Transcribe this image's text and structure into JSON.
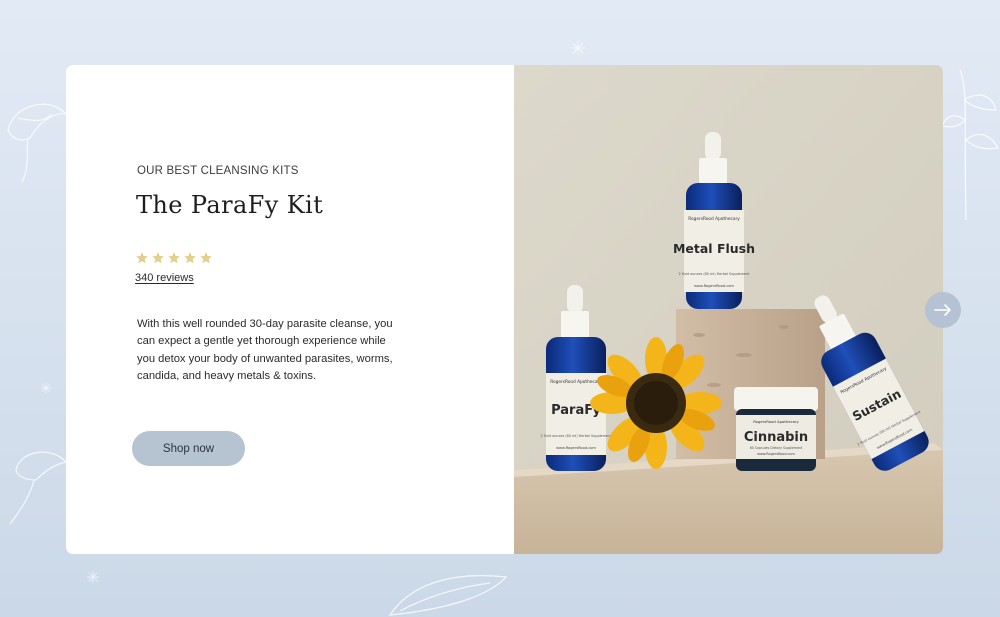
{
  "hero": {
    "eyebrow": "OUR BEST CLEANSING KITS",
    "title": "The ParaFy Kit",
    "rating": {
      "stars": 5,
      "max": 5
    },
    "reviews": "340 reviews",
    "description": "With this well rounded 30-day parasite cleanse, you can expect a gentle yet thorough experience while you detox your body of unwanted parasites, worms, candida, and heavy metals & toxins.",
    "cta_label": "Shop now"
  },
  "products": {
    "bottle_metal_flush": {
      "brand": "RogersRood Apothecary",
      "name": "Metal Flush",
      "sub": "2 fluid ounces (60 ml) Herbal Supplement",
      "url": "www.RogersRood.com"
    },
    "bottle_parafy": {
      "brand": "RogersRood Apothecary",
      "name": "ParaFy",
      "sub": "2 fluid ounces (60 ml) Herbal Supplement",
      "url": "www.RogersRood.com"
    },
    "jar_cinnabin": {
      "brand": "RogersRood Apothecary",
      "name": "Cinnabin",
      "sub": "60 Capsules Dietary Supplement",
      "url": "www.RogersRood.com"
    },
    "bottle_sustain": {
      "brand": "RogersRood Apothecary",
      "name": "Sustain",
      "sub": "2 fluid ounces (60 ml) Herbal Supplement",
      "url": "www.RogersRood.com"
    }
  },
  "colors": {
    "background": "#d9e3ef",
    "button": "#b6c3d1",
    "star": "#e2cf8d",
    "arrow_button": "#b5c2d3"
  },
  "icons": {
    "next": "arrow-right-icon",
    "star": "star-icon"
  }
}
